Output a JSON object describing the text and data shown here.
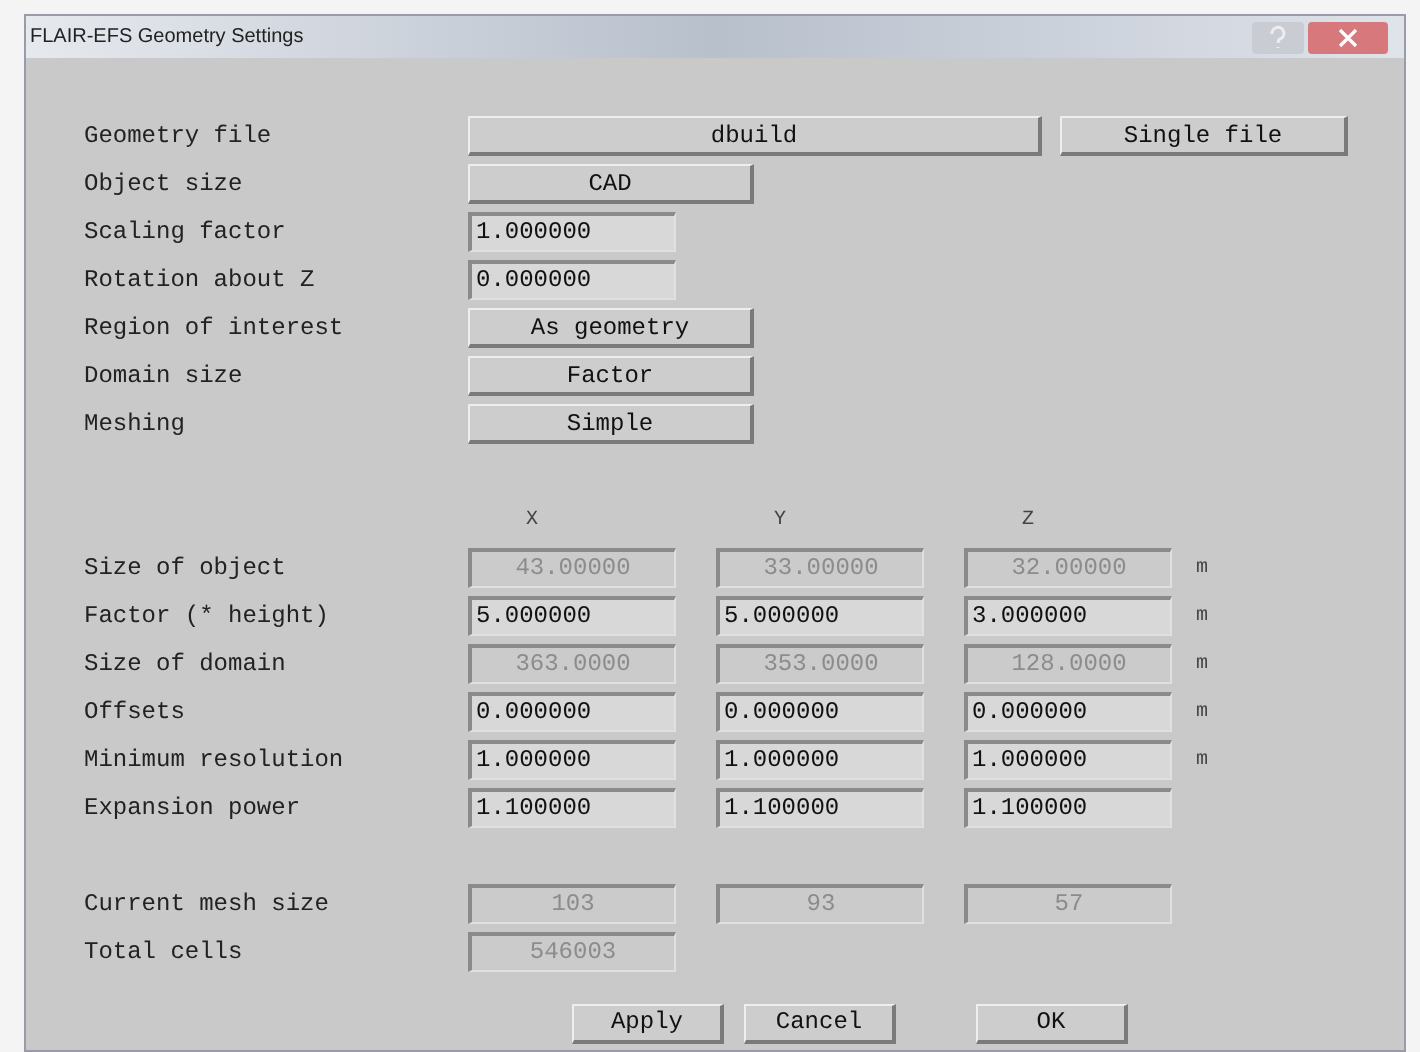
{
  "window": {
    "title": "FLAIR-EFS Geometry Settings"
  },
  "settings": [
    {
      "label": "Geometry file",
      "kind": "file",
      "value": "dbuild",
      "extra": "Single file"
    },
    {
      "label": "Object size",
      "kind": "choice",
      "value": "CAD"
    },
    {
      "label": "Scaling factor",
      "kind": "entry",
      "value": "1.000000"
    },
    {
      "label": "Rotation about Z",
      "kind": "entry",
      "value": "0.000000"
    },
    {
      "label": "Region of interest",
      "kind": "choice",
      "value": "As geometry"
    },
    {
      "label": "Domain size",
      "kind": "choice",
      "value": "Factor"
    },
    {
      "label": "Meshing",
      "kind": "choice",
      "value": "Simple"
    }
  ],
  "axes": [
    "X",
    "Y",
    "Z"
  ],
  "grid": [
    {
      "label": "Size of object",
      "unit": "m",
      "cells": [
        {
          "value": "43.00000",
          "disabled": true
        },
        {
          "value": "33.00000",
          "disabled": true
        },
        {
          "value": "32.00000",
          "disabled": true
        }
      ]
    },
    {
      "label": "Factor (* height)",
      "unit": "m",
      "cells": [
        {
          "value": "5.000000",
          "disabled": false
        },
        {
          "value": "5.000000",
          "disabled": false
        },
        {
          "value": "3.000000",
          "disabled": false
        }
      ]
    },
    {
      "label": "Size of domain",
      "unit": "m",
      "cells": [
        {
          "value": "363.0000",
          "disabled": true
        },
        {
          "value": "353.0000",
          "disabled": true
        },
        {
          "value": "128.0000",
          "disabled": true
        }
      ]
    },
    {
      "label": "Offsets",
      "unit": "m",
      "cells": [
        {
          "value": "0.000000",
          "disabled": false
        },
        {
          "value": "0.000000",
          "disabled": false
        },
        {
          "value": "0.000000",
          "disabled": false
        }
      ]
    },
    {
      "label": "Minimum resolution",
      "unit": "m",
      "cells": [
        {
          "value": "1.000000",
          "disabled": false
        },
        {
          "value": "1.000000",
          "disabled": false
        },
        {
          "value": "1.000000",
          "disabled": false
        }
      ]
    },
    {
      "label": "Expansion power",
      "cells": [
        {
          "value": "1.100000",
          "disabled": false
        },
        {
          "value": "1.100000",
          "disabled": false
        },
        {
          "value": "1.100000",
          "disabled": false
        }
      ]
    }
  ],
  "results": [
    {
      "label": "Current mesh size",
      "cells": [
        "103",
        "93",
        "57"
      ]
    },
    {
      "label": "Total cells",
      "cells": [
        "546003"
      ]
    }
  ],
  "buttons": [
    "Apply",
    "Cancel",
    "OK"
  ]
}
